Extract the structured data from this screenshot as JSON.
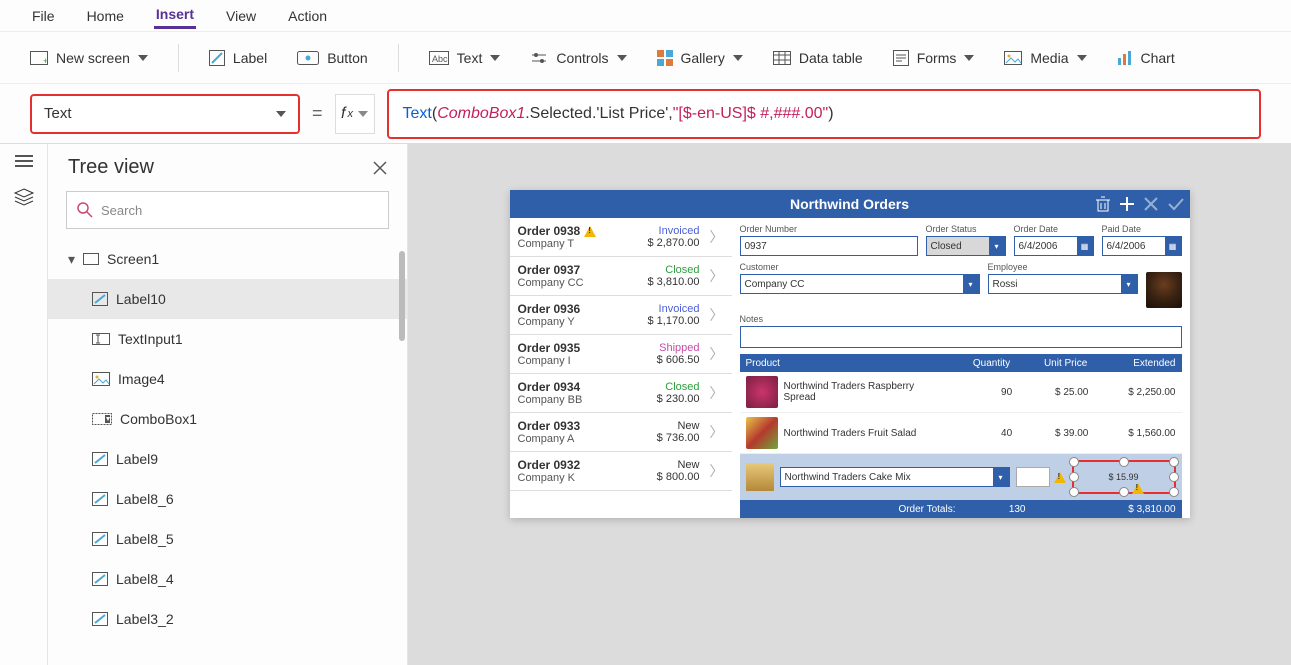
{
  "menu": {
    "items": [
      "File",
      "Home",
      "Insert",
      "View",
      "Action"
    ],
    "active_index": 2
  },
  "ribbon": {
    "new_screen": "New screen",
    "label": "Label",
    "button": "Button",
    "text": "Text",
    "controls": "Controls",
    "gallery": "Gallery",
    "data_table": "Data table",
    "forms": "Forms",
    "media": "Media",
    "chart": "Chart"
  },
  "property_dropdown": {
    "value": "Text"
  },
  "formula": {
    "fn": "Text",
    "id": "ComboBox1",
    "chain": ".Selected.'List Price', ",
    "str": "\"[$-en-US]$ #,###.00\"",
    "plain_open": "( ",
    "plain_close": " )"
  },
  "tree": {
    "title": "Tree view",
    "search_placeholder": "Search",
    "root": "Screen1",
    "nodes": [
      "Label10",
      "TextInput1",
      "Image4",
      "ComboBox1",
      "Label9",
      "Label8_6",
      "Label8_5",
      "Label8_4",
      "Label3_2"
    ],
    "selected": "Label10"
  },
  "app": {
    "title": "Northwind Orders",
    "orders": [
      {
        "num": "Order 0938",
        "company": "Company T",
        "status": "Invoiced",
        "cls": "st-invoiced",
        "amount": "$ 2,870.00",
        "warn": true
      },
      {
        "num": "Order 0937",
        "company": "Company CC",
        "status": "Closed",
        "cls": "st-closed",
        "amount": "$ 3,810.00",
        "warn": false
      },
      {
        "num": "Order 0936",
        "company": "Company Y",
        "status": "Invoiced",
        "cls": "st-invoiced",
        "amount": "$ 1,170.00",
        "warn": false
      },
      {
        "num": "Order 0935",
        "company": "Company I",
        "status": "Shipped",
        "cls": "st-shipped",
        "amount": "$ 606.50",
        "warn": false
      },
      {
        "num": "Order 0934",
        "company": "Company BB",
        "status": "Closed",
        "cls": "st-closed",
        "amount": "$ 230.00",
        "warn": false
      },
      {
        "num": "Order 0933",
        "company": "Company A",
        "status": "New",
        "cls": "st-new",
        "amount": "$ 736.00",
        "warn": false
      },
      {
        "num": "Order 0932",
        "company": "Company K",
        "status": "New",
        "cls": "st-new",
        "amount": "$ 800.00",
        "warn": false
      }
    ],
    "detail": {
      "labels": {
        "order_number": "Order Number",
        "order_status": "Order Status",
        "order_date": "Order Date",
        "paid_date": "Paid Date",
        "customer": "Customer",
        "employee": "Employee",
        "notes": "Notes"
      },
      "order_number": "0937",
      "order_status": "Closed",
      "order_date": "6/4/2006",
      "paid_date": "6/4/2006",
      "customer": "Company CC",
      "employee": "Rossi",
      "notes": ""
    },
    "prod_header": {
      "product": "Product",
      "qty": "Quantity",
      "unit": "Unit Price",
      "ext": "Extended"
    },
    "products": [
      {
        "name": "Northwind Traders Raspberry Spread",
        "qty": "90",
        "unit": "$ 25.00",
        "ext": "$ 2,250.00",
        "bg": "radial-gradient(circle,#c9356a,#7a1f42)"
      },
      {
        "name": "Northwind Traders Fruit Salad",
        "qty": "40",
        "unit": "$ 39.00",
        "ext": "$ 1,560.00",
        "bg": "linear-gradient(135deg,#e8c54a,#b53a2e,#6fa83a)"
      }
    ],
    "addrow": {
      "thumb_bg": "linear-gradient(#e8c97a,#b5883a)",
      "product": "Northwind Traders Cake Mix",
      "selected_label_value": "$ 15.99"
    },
    "totals": {
      "label": "Order Totals:",
      "qty": "130",
      "amount": "$ 3,810.00"
    }
  }
}
